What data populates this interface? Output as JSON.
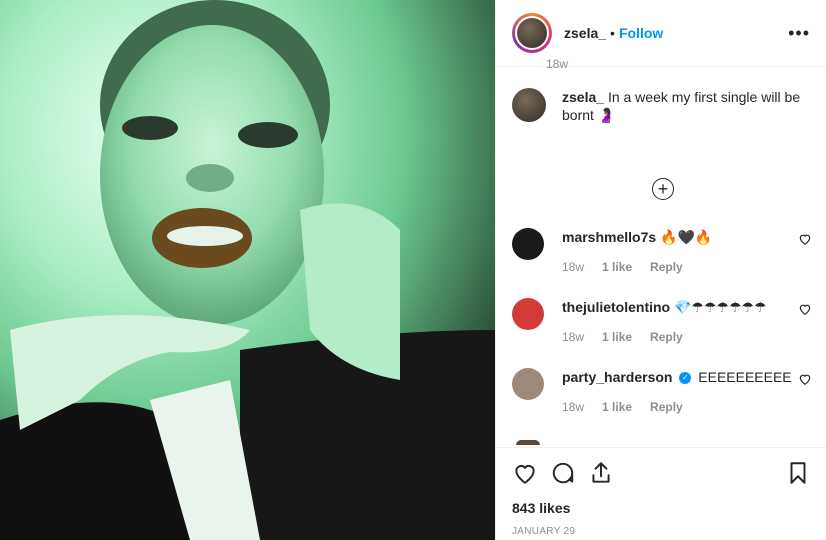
{
  "post": {
    "image_alt": "Selfie of a person with gold lips on a green-tinted background"
  },
  "header": {
    "username": "zsela_",
    "dot": "•",
    "follow_label": "Follow",
    "more_icon": "more-icon"
  },
  "caption": {
    "username": "zsela_",
    "text": "In a week my first single will be bornt 🤰🏾",
    "time": "18w"
  },
  "load_more_icon": "plus-circle-icon",
  "comments": [
    {
      "username": "marshmello7s",
      "text": "🔥🖤🔥",
      "time": "18w",
      "likes": "1 like",
      "reply": "Reply",
      "avatar_color": "#1a1a1a"
    },
    {
      "username": "thejulietolentino",
      "text": "💎☂☂☂☂☂☂",
      "time": "18w",
      "likes": "1 like",
      "reply": "Reply",
      "avatar_color": "#d33a3a"
    },
    {
      "username": "party_harderson",
      "verified": true,
      "text": "EEEEEEEEEE",
      "time": "18w",
      "likes": "1 like",
      "reply": "Reply",
      "avatar_color": "#9c8a78"
    }
  ],
  "actions": {
    "likes": "843 likes",
    "date": "JANUARY 29"
  }
}
